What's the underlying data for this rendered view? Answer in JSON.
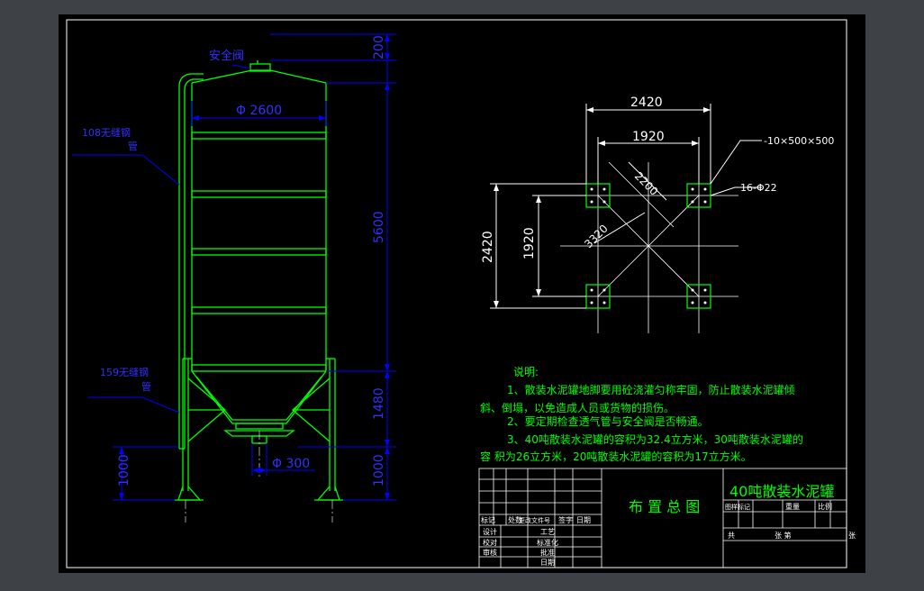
{
  "colors": {
    "background": "#3e4145",
    "paper": "#000000",
    "frame": "#ffffff",
    "tank": "#00ff00",
    "dimension": "#0000ff",
    "leader": "#0000ff",
    "label": "#3030ff",
    "notes": "#00ff00",
    "detail_lines": "#ffffff",
    "title_block": "#ffffff",
    "title_text": "#00ff00"
  },
  "elevation": {
    "safety_valve_label": "安全阀",
    "pipe_108_label_line1": "108无缝钢",
    "pipe_108_label_line2": "管",
    "pipe_159_label_line1": "159无缝钢",
    "pipe_159_label_line2": "管",
    "dim_diameter": "Φ 2600",
    "dim_outlet": "Φ 300",
    "dim_top": "200",
    "dim_body": "5600",
    "dim_cone": "1480",
    "dim_leg": "1000",
    "dim_leg_left": "1000"
  },
  "plan": {
    "dim_outer_h": "2420",
    "dim_inner_h": "1920",
    "dim_outer_v": "2420",
    "dim_inner_v": "1920",
    "dim_diag_1": "2200",
    "dim_diag_2": "3320",
    "plate_label": "-10×500×500",
    "bolt_label": "16-Φ22"
  },
  "notes": {
    "heading": "说明:",
    "line1": "1、散装水泥罐地脚要用砼浇灌匀称牢固，防止散装水泥罐倾",
    "line2": "斜、倒塌，以免造成人员或货物的损伤。",
    "line3": "2、要定期检查透气管与安全阀是否畅通。",
    "line4": "3、40吨散装水泥罐的容积为32.4立方米，30吨散装水泥罐的",
    "line5": "容      积为26立方米，20吨散装水泥罐的容积为17立方米。"
  },
  "title_block": {
    "drawing_name": "布 置 总 图",
    "project_title": "40吨散装水泥罐",
    "rev_headers": [
      "标记",
      "处数",
      "更改文件号",
      "签字",
      "日期"
    ],
    "sign_rows": [
      "设计",
      "校对",
      "审核",
      "工艺",
      "标准化",
      "批准",
      "日期"
    ],
    "info_headers": [
      "图样标记",
      "重量",
      "比例"
    ],
    "sheet_total": "共",
    "sheet_no": "张 第",
    "sheet_end": "张"
  }
}
